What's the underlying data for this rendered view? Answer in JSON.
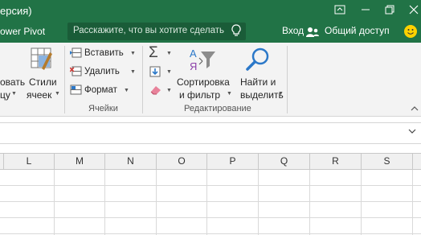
{
  "window": {
    "title_fragment": "ерсия)"
  },
  "tellbar": {
    "tab_fragment": "ower Pivot",
    "search_placeholder": "Расскажите, что вы хотите сделать",
    "signin": "Вход",
    "share": "Общий доступ"
  },
  "ribbon": {
    "format_table_line1": "овать",
    "format_table_line2": "цу",
    "styles_line1": "Стили",
    "styles_line2": "ячеек",
    "insert": "Вставить",
    "delete": "Удалить",
    "format": "Формат",
    "cells_group": "Ячейки",
    "sort_line1": "Сортировка",
    "sort_line2": "и фильтр",
    "find_line1": "Найти и",
    "find_line2": "выделить",
    "editing_group": "Редактирование"
  },
  "columns": [
    "L",
    "M",
    "N",
    "O",
    "P",
    "Q",
    "R",
    "S"
  ],
  "colors": {
    "accent": "#217346",
    "ribbon_bg": "#f3f3f3"
  }
}
